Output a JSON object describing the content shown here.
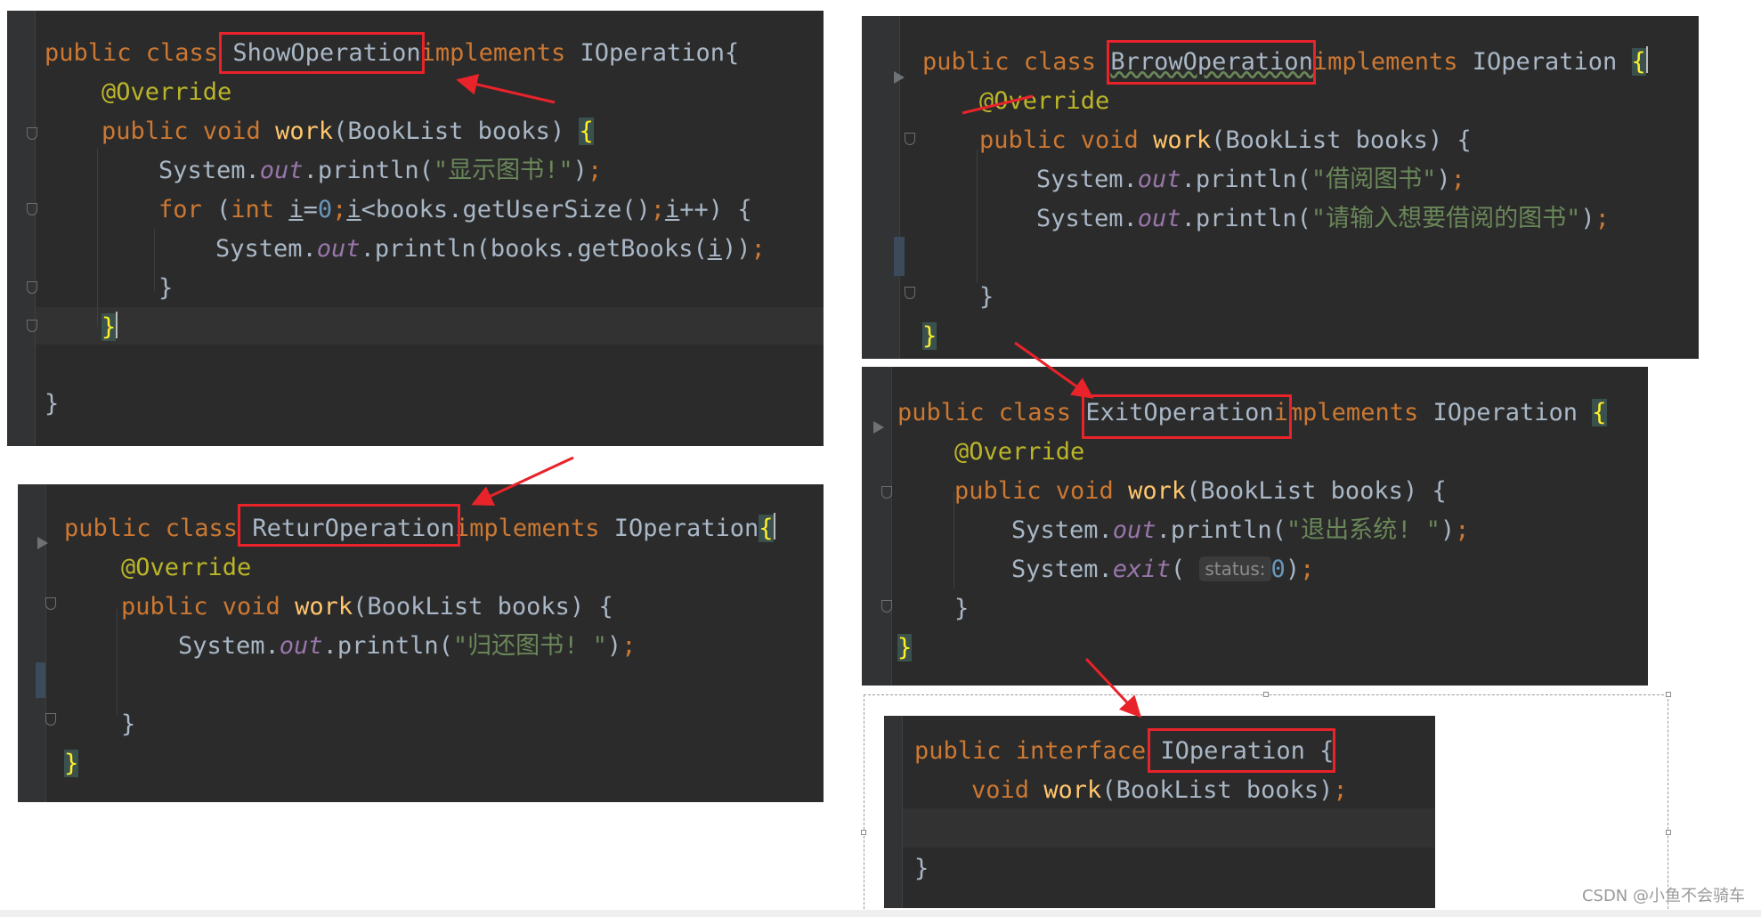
{
  "panels": {
    "show": {
      "line1": {
        "decl": "public class ",
        "name": "ShowOperation",
        "impl": "implements",
        "iface": " IOperation{"
      },
      "line2": "@Override",
      "line3": {
        "kw": "public void ",
        "fn": "work",
        "args": "(BookList books) ",
        "brace": "{"
      },
      "line4": {
        "a": "System.",
        "field": "out",
        "b": ".println(",
        "s": "\"显示图书!\"",
        "c": ")",
        "semi": ";"
      },
      "line5": {
        "kw": "for ",
        "p1": "(",
        "int": "int ",
        "i1": "i",
        "eq": "=",
        "zero": "0",
        "s1": ";",
        "i2": "i",
        "lt": "<books.getUserSize()",
        "s2": ";",
        "i3": "i",
        "inc": "++) {"
      },
      "line6": {
        "a": "System.",
        "field": "out",
        "b": ".println(books.getBooks(",
        "i": "i",
        "c": "))",
        "semi": ";"
      },
      "line7": "}",
      "line8": "}",
      "line9": "}"
    },
    "retur": {
      "line1": {
        "decl": "public class ",
        "name": "ReturOperation",
        "impl": "implements",
        "iface": " IOperation",
        "brace": "{"
      },
      "line2": "@Override",
      "line3": {
        "kw": "public void ",
        "fn": "work",
        "args": "(BookList books) {"
      },
      "line4": {
        "a": "System.",
        "field": "out",
        "b": ".println(",
        "s": "\"归还图书! \"",
        "c": ")",
        "semi": ";"
      },
      "line5": "}",
      "line6": "}"
    },
    "brrow": {
      "line1": {
        "decl": "public class ",
        "name": "BrrowOperation",
        "impl": "implements",
        "iface": " IOperation ",
        "brace": "{"
      },
      "line2": "@Override",
      "line3": {
        "kw": "public void ",
        "fn": "work",
        "args": "(BookList books) {"
      },
      "line4": {
        "a": "System.",
        "field": "out",
        "b": ".println(",
        "s": "\"借阅图书\"",
        "c": ")",
        "semi": ";"
      },
      "line5": {
        "a": "System.",
        "field": "out",
        "b": ".println(",
        "s": "\"请输入想要借阅的图书\"",
        "c": ")",
        "semi": ";"
      },
      "line6": "}",
      "line7": "}"
    },
    "exit": {
      "line1": {
        "decl": "public class ",
        "name": "ExitOperation",
        "impl": "implements",
        "iface": " IOperation ",
        "brace": "{"
      },
      "line2": "@Override",
      "line3": {
        "kw": "public void ",
        "fn": "work",
        "args": "(BookList books) {"
      },
      "line4": {
        "a": "System.",
        "field": "out",
        "b": ".println(",
        "s": "\"退出系统! \"",
        "c": ")",
        "semi": ";"
      },
      "line5": {
        "a": "System.",
        "fn": "exit",
        "p": "( ",
        "hint": "status:",
        "num": "0",
        "c": ")",
        "semi": ";"
      },
      "line6": "}",
      "line7": "}"
    },
    "iface": {
      "line1": {
        "decl": "public interface ",
        "name": "IOperation",
        "brace": " {"
      },
      "line2": {
        "kw": "void ",
        "fn": "work",
        "args": "(BookList books)",
        "semi": ";"
      },
      "line3": "}"
    }
  },
  "watermark": "CSDN @小鱼不会骑车",
  "colors": {
    "editor_bg": "#2b2b2b",
    "keyword": "#cc7832",
    "annotation": "#bbb529",
    "method": "#ffc66d",
    "string": "#6a8759",
    "text": "#a9b7c6",
    "highlight_box": "#e8232a"
  }
}
